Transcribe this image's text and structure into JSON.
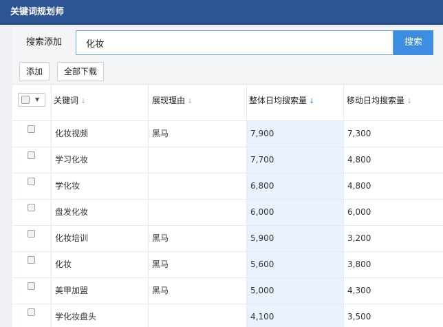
{
  "window": {
    "title": "关键词规划师"
  },
  "search": {
    "label": "搜索添加",
    "value": "化妆",
    "button_label": "搜索"
  },
  "toolbar": {
    "add_label": "添加",
    "download_all_label": "全部下载"
  },
  "table": {
    "columns": [
      {
        "label": "关键词",
        "sort_icon": "sort-arrow-down-icon",
        "sort_active": false
      },
      {
        "label": "展现理由",
        "sort_icon": "sort-arrow-down-icon",
        "sort_active": false
      },
      {
        "label": "整体日均搜索量",
        "sort_icon": "sort-arrow-down-icon",
        "sort_active": true
      },
      {
        "label": "移动日均搜索量",
        "sort_icon": "sort-arrow-down-icon",
        "sort_active": false
      }
    ],
    "sort_symbol": "↓",
    "highlight_color": "#eaf3fd",
    "accent_color": "#3d8de0",
    "rows": [
      {
        "keyword": "化妆视频",
        "reason": "黑马",
        "overall": "7,900",
        "mobile": "7,300"
      },
      {
        "keyword": "学习化妆",
        "reason": "",
        "overall": "7,700",
        "mobile": "4,800"
      },
      {
        "keyword": "学化妆",
        "reason": "",
        "overall": "6,800",
        "mobile": "4,800"
      },
      {
        "keyword": "盘发化妆",
        "reason": "",
        "overall": "6,000",
        "mobile": "6,000"
      },
      {
        "keyword": "化妆培训",
        "reason": "黑马",
        "overall": "5,900",
        "mobile": "3,200"
      },
      {
        "keyword": "化妆",
        "reason": "黑马",
        "overall": "5,600",
        "mobile": "3,800"
      },
      {
        "keyword": "美甲加盟",
        "reason": "黑马",
        "overall": "5,000",
        "mobile": "4,300"
      },
      {
        "keyword": "学化妆盘头",
        "reason": "",
        "overall": "4,100",
        "mobile": "3,500"
      }
    ]
  }
}
